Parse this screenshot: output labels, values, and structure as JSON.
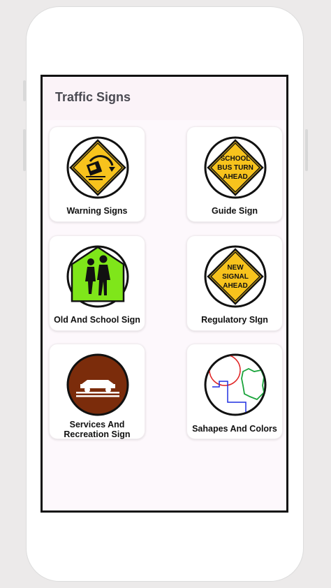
{
  "app": {
    "title": "Traffic Signs"
  },
  "cards": [
    {
      "label": "Warning Signs"
    },
    {
      "label": "Guide Sign",
      "sign_text": [
        "SCHOOL",
        "BUS TURN",
        "AHEAD"
      ]
    },
    {
      "label": "Old And School Sign"
    },
    {
      "label": "Regulatory  SIgn",
      "sign_text": [
        "NEW",
        "SIGNAL",
        "AHEAD"
      ]
    },
    {
      "label_lines": [
        "Services And",
        "Recreation Sign"
      ]
    },
    {
      "label": "Sahapes And Colors"
    }
  ],
  "colors": {
    "yellow": "#f7c31d",
    "green": "#7fe61a",
    "brown": "#7b2c0b",
    "circle_border": "#111111"
  }
}
